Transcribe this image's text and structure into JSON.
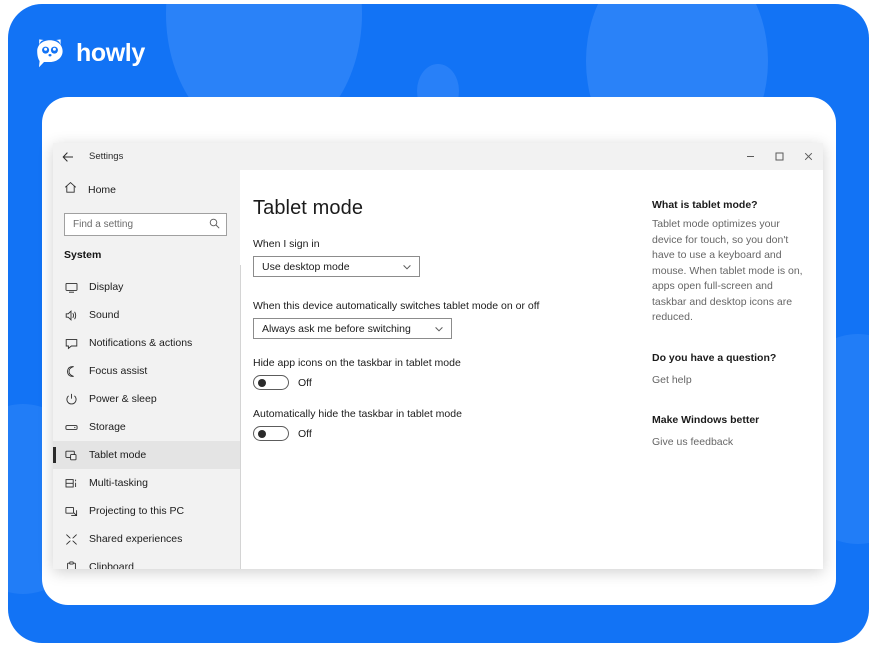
{
  "brand": {
    "name": "howly",
    "logo_icon": "owl-mascot-icon",
    "background_color": "#1273f5",
    "blob_color": "#3a8bfa"
  },
  "window": {
    "titlebar": {
      "back_icon": "back-arrow-icon",
      "title": "Settings",
      "minimize_icon": "minimize-icon",
      "maximize_icon": "maximize-icon",
      "close_icon": "close-icon"
    }
  },
  "sidebar": {
    "home": {
      "icon": "home-icon",
      "label": "Home"
    },
    "search": {
      "placeholder": "Find a setting",
      "value": "",
      "icon": "search-icon"
    },
    "group_title": "System",
    "items": [
      {
        "label": "Display",
        "icon": "monitor-icon",
        "selected": false
      },
      {
        "label": "Sound",
        "icon": "speaker-icon",
        "selected": false
      },
      {
        "label": "Notifications & actions",
        "icon": "notification-icon",
        "selected": false
      },
      {
        "label": "Focus assist",
        "icon": "moon-icon",
        "selected": false
      },
      {
        "label": "Power & sleep",
        "icon": "power-icon",
        "selected": false
      },
      {
        "label": "Storage",
        "icon": "drive-icon",
        "selected": false
      },
      {
        "label": "Tablet mode",
        "icon": "tablet-icon",
        "selected": true
      },
      {
        "label": "Multi-tasking",
        "icon": "multitasking-icon",
        "selected": false
      },
      {
        "label": "Projecting to this PC",
        "icon": "project-screen-icon",
        "selected": false
      },
      {
        "label": "Shared experiences",
        "icon": "shared-icon",
        "selected": false
      },
      {
        "label": "Clipboard",
        "icon": "clipboard-icon",
        "selected": false
      }
    ]
  },
  "main": {
    "page_title": "Tablet mode",
    "sign_in": {
      "label": "When I sign in",
      "value": "Use desktop mode",
      "chevron_icon": "chevron-down-icon"
    },
    "auto_switch": {
      "label": "When this device automatically switches tablet mode on or off",
      "value": "Always ask me before switching",
      "chevron_icon": "chevron-down-icon"
    },
    "hide_app_icons": {
      "label": "Hide app icons on the taskbar in tablet mode",
      "state": "Off"
    },
    "auto_hide_taskbar": {
      "label": "Automatically hide the taskbar in tablet mode",
      "state": "Off"
    }
  },
  "help": {
    "about": {
      "heading": "What is tablet mode?",
      "body": "Tablet mode optimizes your device for touch, so you don't have to use a keyboard and mouse. When tablet mode is on, apps open full-screen and taskbar and desktop icons are reduced."
    },
    "question": {
      "heading": "Do you have a question?",
      "link": "Get help"
    },
    "feedback": {
      "heading": "Make Windows better",
      "link": "Give us feedback"
    }
  }
}
